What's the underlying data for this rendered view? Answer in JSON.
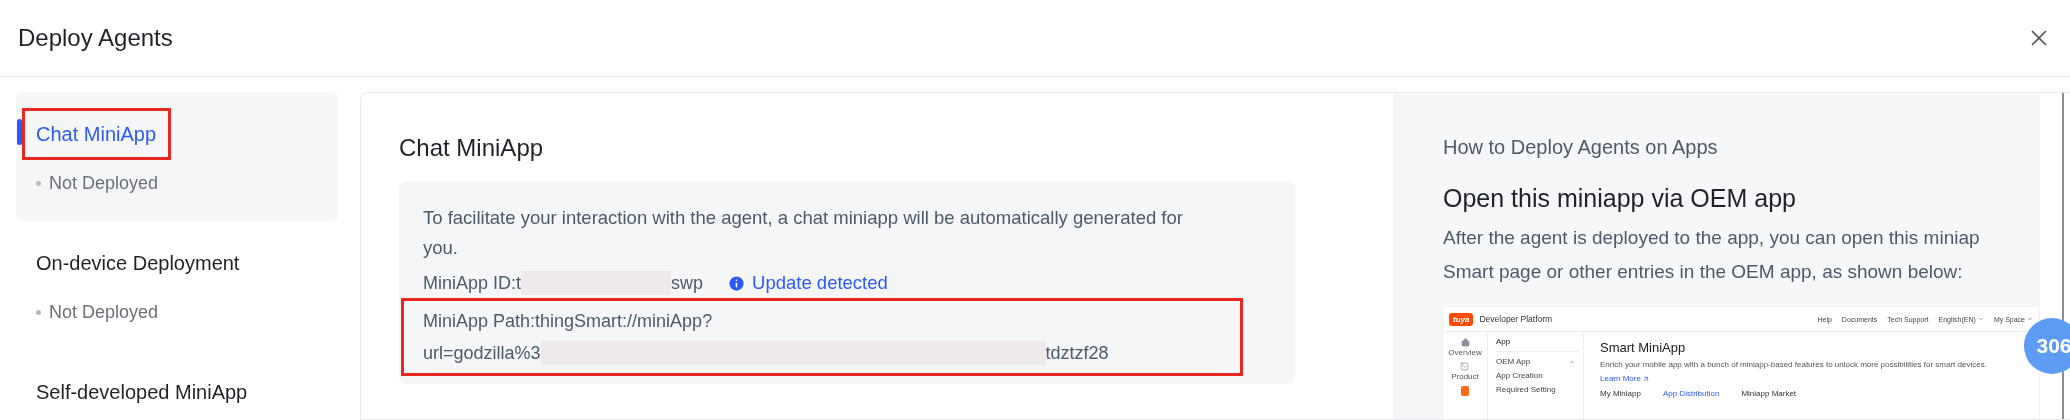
{
  "dialog": {
    "title": "Deploy Agents"
  },
  "sidebar": {
    "items": [
      {
        "label": "Chat MiniApp",
        "status": "Not Deployed",
        "selected": true,
        "annotated": true
      },
      {
        "label": "On-device Deployment",
        "status": "Not Deployed",
        "selected": false,
        "annotated": false
      },
      {
        "label": "Self-developed MiniApp",
        "selected": false,
        "annotated": false
      }
    ]
  },
  "detail": {
    "title": "Chat MiniApp",
    "description": "To facilitate your interaction with the agent, a chat miniapp will be automatically generated for you.",
    "miniapp_id": {
      "prefix": "MiniApp ID:t",
      "suffix": "swp",
      "redacted": true
    },
    "update_notice": "Update detected",
    "miniapp_path": {
      "annotated": true,
      "line_1": "MiniApp Path:thingSmart://miniApp?",
      "prefix": "url=godzilla%3",
      "suffix": "tdztzf28",
      "redacted": true
    }
  },
  "guide": {
    "heading": "How to Deploy Agents on Apps",
    "title": "Open this miniapp via OEM app",
    "paragraph_lines": [
      "After the agent is deployed to the app, you can open this miniap",
      "Smart page or other entries in the OEM app, as shown below:"
    ],
    "screenshot": {
      "logo": "tuya",
      "platform": "Developer Platform",
      "nav": [
        {
          "label": "Help",
          "kind": "link"
        },
        {
          "label": "Documents",
          "kind": "link"
        },
        {
          "label": "Tech Support",
          "kind": "link"
        },
        {
          "label": "English(EN)",
          "kind": "dropdown"
        },
        {
          "label": "My Space",
          "kind": "dropdown"
        }
      ],
      "rail": [
        {
          "label": "Overview",
          "kind": "home"
        },
        {
          "label": "Product",
          "kind": "terminal"
        },
        {
          "kind": "app"
        }
      ],
      "menu_title": "App",
      "menu": [
        {
          "label": "OEM App",
          "expanded": true
        },
        {
          "label": "App Creation"
        },
        {
          "label": "Required Setting"
        }
      ],
      "page_title": "Smart MiniApp",
      "page_description": "Enrich your mobile app with a bunch of miniapp-based features to unlock more possibilities for smart devices.",
      "learn_more": "Learn More",
      "tabs": [
        {
          "label": "My Miniapp",
          "selected": false
        },
        {
          "label": "App Distribution",
          "selected": true
        },
        {
          "label": "Miniapp Market",
          "selected": false
        }
      ]
    }
  },
  "chat_badge": {
    "count": "306"
  }
}
